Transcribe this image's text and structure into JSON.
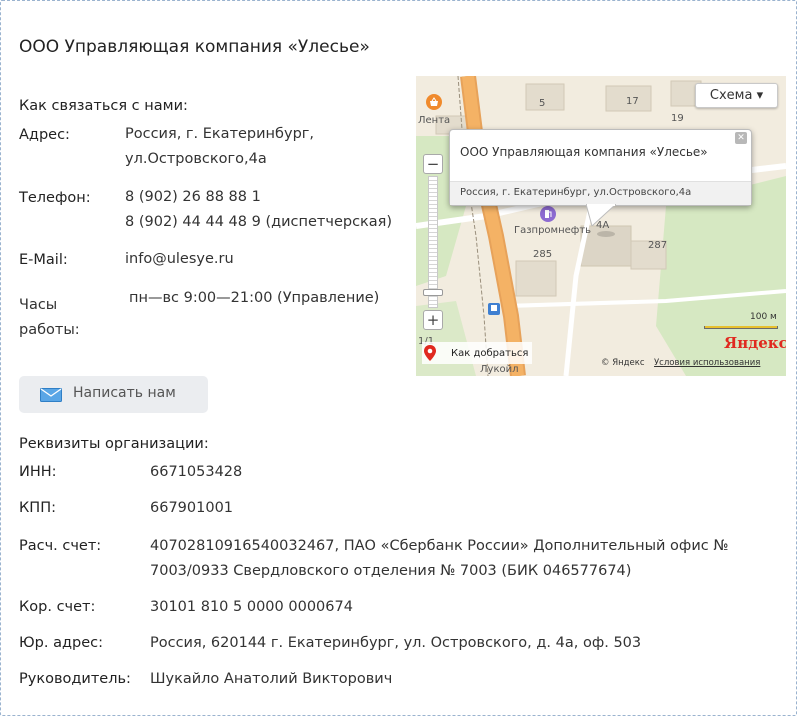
{
  "company": {
    "title": "ООО Управляющая компания «Улесье»"
  },
  "contacts": {
    "heading": "Как связаться с нами:",
    "address_label": "Адрес:",
    "address_lines": [
      "Россия, г. Екатеринбург,",
      "ул.Островского,4а"
    ],
    "phone_label": "Телефон:",
    "phone_lines": [
      "8 (902) 26 88 88 1",
      "8 (902) 44 44 48 9 (диспетчерская)"
    ],
    "email_label": "E-Mail:",
    "email": "info@ulesye.ru",
    "hours_label_lines": [
      "Часы",
      "работы:"
    ],
    "hours": "пн—вс 9:00—21:00 (Управление)"
  },
  "write_button": {
    "label": "Написать нам",
    "icon": "envelope-icon"
  },
  "map": {
    "scheme_label": "Схема ▾",
    "zoom_in": "+",
    "zoom_out": "−",
    "balloon_title": "ООО Управляющая компания «Улесье»",
    "balloon_address": "Россия, г. Екатеринбург, ул.Островского,4а",
    "balloon_close": "✕",
    "places": {
      "lenta": "Лента",
      "gazpromneft": "Газпромнефть",
      "lukoil": "Лукойл"
    },
    "house_numbers": [
      "5",
      "17",
      "19",
      "4А",
      "287",
      "285",
      "1/1"
    ],
    "route_label": "Как добраться",
    "scale_label": "100 м",
    "logo": "Яндекс",
    "copyright": "© Яндекс",
    "terms": "Условия использования"
  },
  "requisites": {
    "heading": "Реквизиты организации:",
    "rows": [
      {
        "label": "ИНН:",
        "lines": [
          "6671053428"
        ]
      },
      {
        "label": "КПП:",
        "lines": [
          "667901001"
        ]
      },
      {
        "label": "Расч. счет:",
        "lines": [
          "40702810916540032467, ПАО «Сбербанк России» Дополнительный офис №",
          "7003/0933 Свердловского отделения № 7003 (БИК 046577674)"
        ]
      },
      {
        "label": "Кор. счет:",
        "lines": [
          "30101 810 5 0000 0000674"
        ]
      },
      {
        "label": "Юр. адрес:",
        "lines": [
          "Россия, 620144 г. Екатеринбург, ул. Островского, д. 4а, оф. 503"
        ]
      },
      {
        "label": "Руководитель:",
        "lines": [
          "Шукайло Анатолий Викторович"
        ]
      }
    ]
  },
  "colors": {
    "border": "#9ab3cf",
    "button_bg": "#ebedf0",
    "road": "#f4b265",
    "park": "#d6e8c2",
    "logo_red": "#e0291f"
  }
}
